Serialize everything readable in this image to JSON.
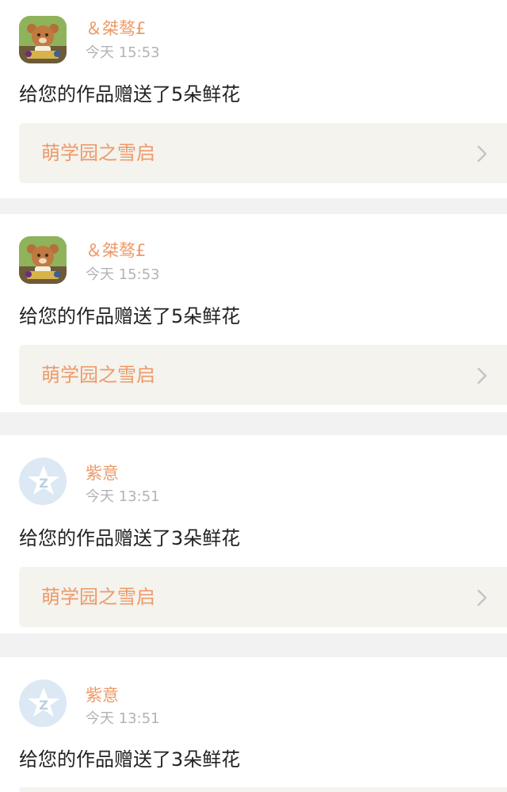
{
  "notifications": [
    {
      "username": "＆桀骜£",
      "time": "今天 15:53",
      "message": "给您的作品赠送了5朵鲜花",
      "work_title": "萌学园之雪启",
      "avatar": "bear-avatar"
    },
    {
      "username": "＆桀骜£",
      "time": "今天 15:53",
      "message": "给您的作品赠送了5朵鲜花",
      "work_title": "萌学园之雪启",
      "avatar": "bear-avatar"
    },
    {
      "username": "紫意",
      "time": "今天 13:51",
      "message": "给您的作品赠送了3朵鲜花",
      "work_title": "萌学园之雪启",
      "avatar": "default-z-avatar"
    },
    {
      "username": "紫意",
      "time": "今天 13:51",
      "message": "给您的作品赠送了3朵鲜花",
      "work_title": "",
      "avatar": "default-z-avatar"
    }
  ],
  "colors": {
    "accent": "#ee9a68",
    "text": "#222222",
    "muted": "#b3b3b3",
    "link_bg": "#f4f3ee",
    "page_bg": "#f2f2f2"
  }
}
